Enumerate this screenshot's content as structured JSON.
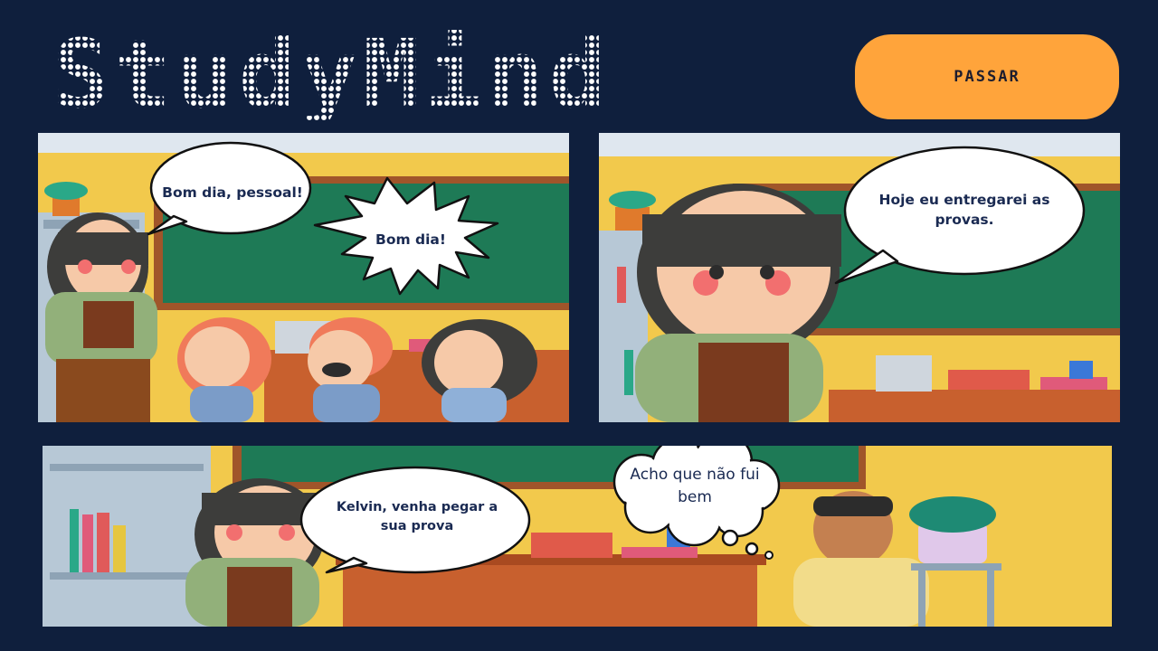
{
  "app": {
    "logo_text": "StudyMind"
  },
  "controls": {
    "pass_label": "PASSAR"
  },
  "panels": [
    {
      "bubbles": [
        "Bom dia, pessoal!",
        "Bom dia!"
      ]
    },
    {
      "bubbles": [
        "Hoje eu entregarei as provas."
      ]
    },
    {
      "bubbles": [
        "Kelvin, venha pegar a sua prova",
        "Acho que não fui bem"
      ]
    }
  ],
  "colors": {
    "background": "#0f1f3d",
    "button": "#ffa43b",
    "chalkboard": "#1e7a56",
    "wall": "#f2c94c",
    "desk": "#c8602e"
  }
}
